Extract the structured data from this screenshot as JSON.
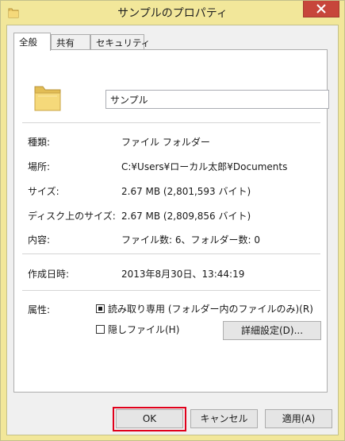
{
  "window": {
    "title": "サンプルのプロパティ",
    "colors": {
      "frame": "#f2e79a",
      "close": "#c7463b",
      "highlight": "#e0001b"
    }
  },
  "tabs": [
    {
      "label": "全般",
      "active": true
    },
    {
      "label": "共有",
      "active": false
    },
    {
      "label": "セキュリティ",
      "active": false
    }
  ],
  "general": {
    "name_value": "サンプル",
    "rows": [
      {
        "label": "種類:",
        "value": "ファイル フォルダー"
      },
      {
        "label": "場所:",
        "value": "C:¥Users¥ローカル太郎¥Documents"
      },
      {
        "label": "サイズ:",
        "value": "2.67 MB (2,801,593 バイト)"
      },
      {
        "label": "ディスク上のサイズ:",
        "value": "2.67 MB (2,809,856 バイト)"
      },
      {
        "label": "内容:",
        "value": "ファイル数: 6、フォルダー数: 0"
      }
    ],
    "created": {
      "label": "作成日時:",
      "value": "2013年8月30日、13:44:19"
    },
    "attributes": {
      "label": "属性:",
      "readonly": {
        "label": "読み取り専用 (フォルダー内のファイルのみ)(R)",
        "state": "mixed"
      },
      "hidden": {
        "label": "隠しファイル(H)",
        "state": "unchecked"
      },
      "advanced_label": "詳細設定(D)..."
    }
  },
  "buttons": {
    "ok": "OK",
    "cancel": "キャンセル",
    "apply": "適用(A)"
  }
}
